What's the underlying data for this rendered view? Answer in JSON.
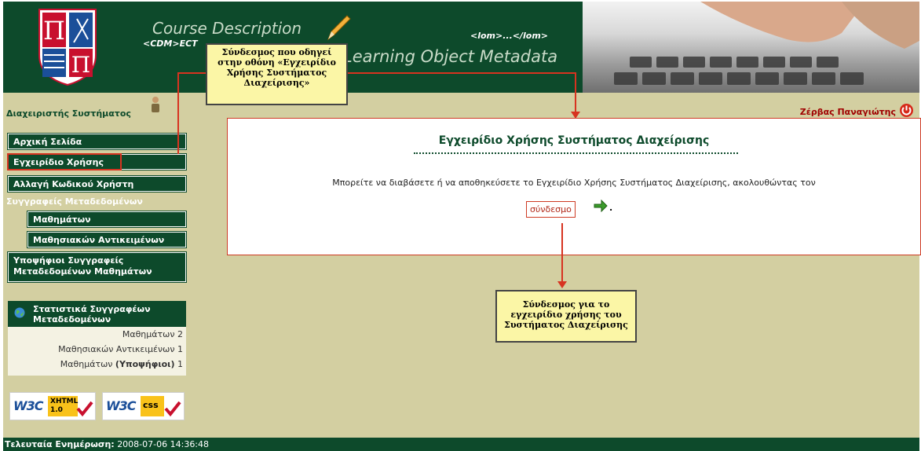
{
  "header": {
    "cdm_title": "Course Description",
    "cdm_tag": "<CDM>ECT",
    "lom_tag": "<lom>...</lom>",
    "lom_title": "Learning Object Metadata"
  },
  "admin_label": "Διαχειριστής Συστήματος",
  "user_name": "Ζέρβας Παναγιώτης",
  "nav": {
    "home": "Αρχική Σελίδα",
    "manual": "Εγχειρίδιο Χρήσης",
    "password": "Αλλαγή Κωδικού Χρήστη",
    "authors_heading": "Συγγραφείς Μεταδεδομένων",
    "courses": "Μαθημάτων",
    "objects": "Μαθησιακών Αντικειμένων",
    "candidates": "Υποψήφιοι Συγγραφείς Μεταδεδομένων Μαθημάτων"
  },
  "stats": {
    "title": "Στατιστικά Συγγραφέων Μεταδεδομένων",
    "rows": [
      {
        "label": "Μαθημάτων",
        "suffix": "",
        "value": "2"
      },
      {
        "label": "Μαθησιακών Αντικειμένων",
        "suffix": "",
        "value": "1"
      },
      {
        "label": "Μαθημάτων",
        "suffix": "(Υποψήφιοι)",
        "value": "1"
      }
    ]
  },
  "badges": {
    "w3c": "W3C",
    "xhtml": "XHTML",
    "xhtml_version": "1.0",
    "css": "css"
  },
  "footer": {
    "label": "Τελευταία Ενημέρωση:",
    "timestamp": "2008-07-06 14:36:48"
  },
  "content": {
    "title": "Εγχειρίδιο Χρήσης Συστήματος Διαχείρισης",
    "text": "Μπορείτε να διαβάσετε ή να αποθηκεύσετε το Εγχειρίδιο Χρήσης Συστήματος Διαχείρισης, ακολουθώντας τον",
    "link": "σύνδεσμο",
    "dot": "."
  },
  "annotations": {
    "top": "Σύνδεσμος που οδηγεί στην οθόνη «Εγχειρίδιο Χρήσης Συστήματος Διαχείρισης»",
    "bottom": "Σύνδεσμος για το εγχειρίδιο χρήσης του Συστήματος Διαχείρισης"
  },
  "colors": {
    "brand_green": "#0d4a2b",
    "background": "#d3cfa1",
    "accent_red": "#d73320"
  }
}
